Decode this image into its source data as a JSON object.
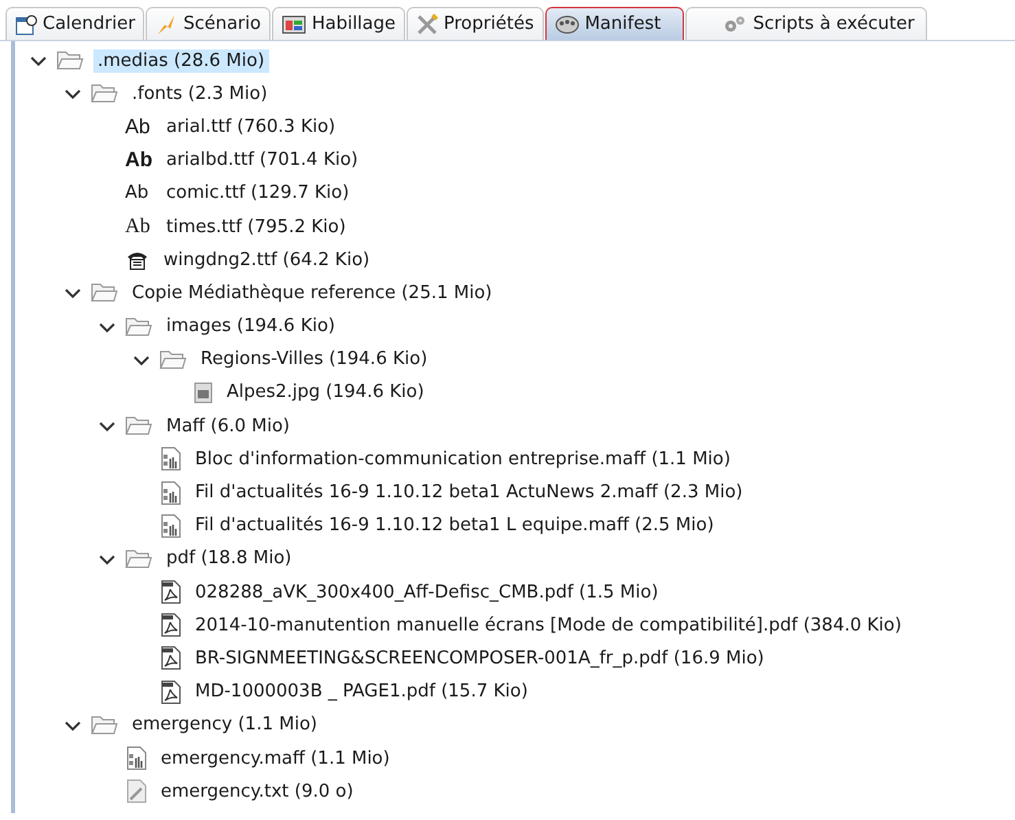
{
  "tabs": [
    {
      "label": "Calendrier",
      "kind": "calendar",
      "selected": false
    },
    {
      "label": "Scénario",
      "kind": "scenario",
      "selected": false
    },
    {
      "label": "Habillage",
      "kind": "skin",
      "selected": false
    },
    {
      "label": "Propriétés",
      "kind": "tools",
      "selected": false
    },
    {
      "label": "Manifest",
      "kind": "manifest",
      "selected": true
    },
    {
      "label": "Scripts à exécuter",
      "kind": "scripts",
      "selected": false
    }
  ],
  "tree": [
    {
      "kind": "folder",
      "label": ".medias (28.6 Mio)",
      "expanded": true,
      "selected": true,
      "children": [
        {
          "kind": "folder",
          "label": ".fonts (2.3 Mio)",
          "expanded": true,
          "selected": false,
          "children": [
            {
              "kind": "sans-font",
              "glyph": "Ab",
              "label": "arial.ttf (760.3 Kio)",
              "selected": false
            },
            {
              "kind": "bold-font",
              "glyph": "Ab",
              "label": "arialbd.ttf (701.4 Kio)",
              "selected": false
            },
            {
              "kind": "comic-font",
              "glyph": "Ab",
              "label": "comic.ttf (129.7 Kio)",
              "selected": false
            },
            {
              "kind": "serif-font",
              "glyph": "Ab",
              "label": "times.ttf (795.2 Kio)",
              "selected": false
            },
            {
              "kind": "symbol-font",
              "label": "wingdng2.ttf (64.2 Kio)",
              "selected": false
            }
          ]
        },
        {
          "kind": "folder",
          "label": "Copie Médiathèque reference (25.1 Mio)",
          "expanded": true,
          "selected": false,
          "children": [
            {
              "kind": "folder",
              "label": "images (194.6 Kio)",
              "expanded": true,
              "selected": false,
              "children": [
                {
                  "kind": "folder",
                  "label": "Regions-Villes (194.6 Kio)",
                  "expanded": true,
                  "selected": false,
                  "children": [
                    {
                      "kind": "image",
                      "label": "Alpes2.jpg (194.6 Kio)",
                      "selected": false
                    }
                  ]
                }
              ]
            },
            {
              "kind": "folder",
              "label": "Maff (6.0 Mio)",
              "expanded": true,
              "selected": false,
              "children": [
                {
                  "kind": "maff",
                  "label": "Bloc d'information-communication entreprise.maff (1.1 Mio)",
                  "selected": false
                },
                {
                  "kind": "maff",
                  "label": "Fil d'actualités 16-9 1.10.12 beta1 ActuNews 2.maff (2.3 Mio)",
                  "selected": false
                },
                {
                  "kind": "maff",
                  "label": "Fil d'actualités 16-9 1.10.12 beta1 L equipe.maff (2.5 Mio)",
                  "selected": false
                }
              ]
            },
            {
              "kind": "folder",
              "label": "pdf (18.8 Mio)",
              "expanded": true,
              "selected": false,
              "children": [
                {
                  "kind": "pdf",
                  "label": "028288_aVK_300x400_Aff-Defisc_CMB.pdf (1.5 Mio)",
                  "selected": false
                },
                {
                  "kind": "pdf",
                  "label": "2014-10-manutention manuelle écrans [Mode de compatibilité].pdf (384.0 Kio)",
                  "selected": false
                },
                {
                  "kind": "pdf",
                  "label": "BR-SIGNMEETING&SCREENCOMPOSER-001A_fr_p.pdf (16.9 Mio)",
                  "selected": false
                },
                {
                  "kind": "pdf",
                  "label": "MD-1000003B _ PAGE1.pdf (15.7 Kio)",
                  "selected": false
                }
              ]
            }
          ]
        },
        {
          "kind": "folder",
          "label": "emergency (1.1 Mio)",
          "expanded": true,
          "selected": false,
          "children": [
            {
              "kind": "maff",
              "label": "emergency.maff (1.1 Mio)",
              "selected": false
            },
            {
              "kind": "text",
              "label": "emergency.txt (9.0 o)",
              "selected": false
            }
          ]
        }
      ]
    }
  ]
}
